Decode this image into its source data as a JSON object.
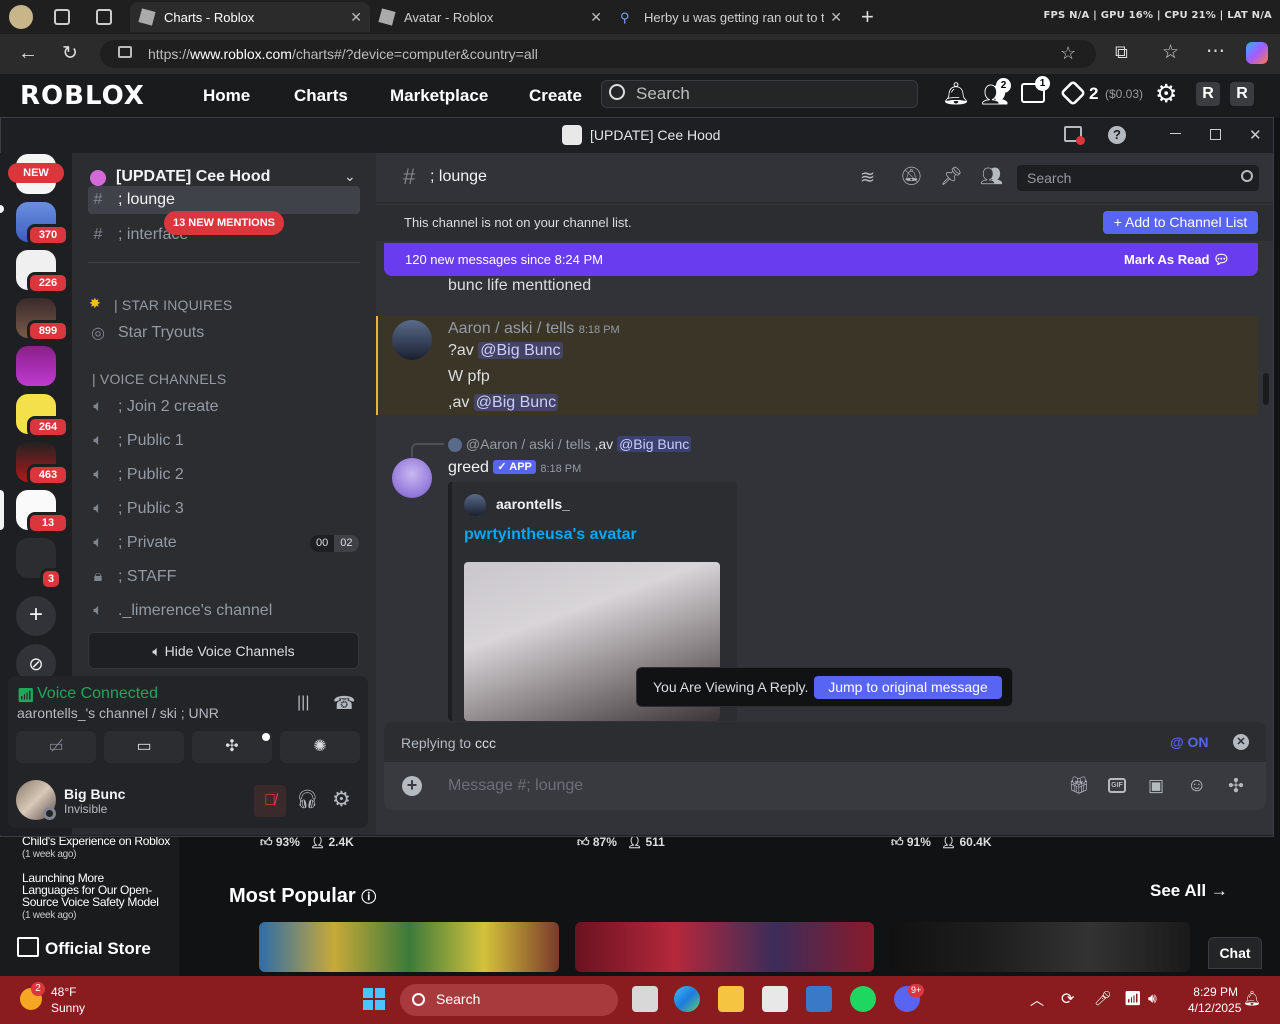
{
  "browser": {
    "tabs": [
      {
        "label": "Charts - Roblox",
        "active": true
      },
      {
        "label": "Avatar - Roblox",
        "active": false
      },
      {
        "label": "Herby u was getting ran out to th",
        "active": false
      }
    ],
    "perf": "FPS N/A | GPU 16% | CPU 21% | LAT N/A",
    "url_prefix": "https://",
    "url_host": "www.roblox.com",
    "url_path": "/charts#/?device=computer&country=all"
  },
  "roblox": {
    "logo": "ROBLOX",
    "nav": [
      "Home",
      "Charts",
      "Marketplace",
      "Create"
    ],
    "search_placeholder": "Search",
    "friend_badge": "2",
    "msg_badge": "1",
    "robux": "2",
    "robux_value": "($0.03)",
    "news": [
      {
        "title": "Child's Experience on Roblox",
        "age": "(1 week ago)"
      },
      {
        "title": "Launching More Languages for Our Open-Source Voice Safety Model",
        "age": "(1 week ago)"
      }
    ],
    "official_store": "Official Store",
    "stats": [
      {
        "like": "93%",
        "players": "2.4K"
      },
      {
        "like": "87%",
        "players": "511"
      },
      {
        "like": "91%",
        "players": "60.4K"
      }
    ],
    "most_popular": "Most Popular",
    "see_all": "See All",
    "chat": "Chat"
  },
  "discord": {
    "window_title": "[UPDATE] Cee Hood",
    "new_badge": "NEW",
    "server_counts": [
      "370",
      "226",
      "899",
      "264",
      "463",
      "13",
      "3"
    ],
    "guild_name": "[UPDATE] Cee Hood",
    "mentions_pill": "13 NEW MENTIONS",
    "channels_top": [
      {
        "name": "; lounge"
      },
      {
        "name": "; interface"
      }
    ],
    "star_category": "| STAR INQUIRES",
    "star_tryouts": "Star Tryouts",
    "voice_category": "| VOICE CHANNELS",
    "voice_channels": [
      {
        "name": "; Join 2 create",
        "icon": "speaker-icon"
      },
      {
        "name": "; Public 1",
        "icon": "speaker-icon"
      },
      {
        "name": "; Public 2",
        "icon": "speaker-icon"
      },
      {
        "name": "; Public 3",
        "icon": "speaker-icon"
      },
      {
        "name": "; Private",
        "icon": "speaker-icon",
        "users": "00",
        "limit": "02"
      },
      {
        "name": "; STAFF",
        "icon": "lock-icon"
      },
      {
        "name": "._limerence's channel",
        "icon": "speaker-icon"
      }
    ],
    "hide_voice": "Hide Voice Channels",
    "voice_connected": "Voice Connected",
    "voice_channel_path": "aarontells_'s channel / ski ; UNR",
    "user_name": "Big Bunc",
    "user_status": "Invisible",
    "channel_header": "; lounge",
    "search_placeholder": "Search",
    "notice": "This channel is not on your channel list.",
    "add_channel_list": "Add to Channel List",
    "new_messages": "120 new messages since 8:24 PM",
    "mark_as_read": "Mark As Read",
    "messages": {
      "m0_text": "bunc life menttioned",
      "m1_author": "Aaron / aski / tells",
      "m1_time": "8:18 PM",
      "m1_line1_prefix": "?av",
      "m1_line1_mention": "@Big Bunc",
      "m1_line2": "W pfp",
      "m1_line3_prefix": ",av",
      "m1_line3_mention": "@Big Bunc",
      "reply_ref_author": "@Aaron / aski / tells",
      "reply_ref_text": ",av",
      "reply_ref_mention": "@Big Bunc",
      "m2_author": "greed",
      "m2_tag": "APP",
      "m2_time": "8:18 PM",
      "embed_author": "aarontells_",
      "embed_title": "pwrtyintheusa's avatar"
    },
    "viewing_reply": "You Are Viewing A Reply.",
    "jump_original": "Jump to original message",
    "replying_to_label": "Replying to",
    "replying_to_name": "ccc",
    "mention_toggle": "@ ON",
    "message_placeholder": "Message #; lounge"
  },
  "taskbar": {
    "weather_badge": "2",
    "temp": "48°F",
    "condition": "Sunny",
    "search": "Search",
    "discord_badge": "9+",
    "time": "8:29 PM",
    "date": "4/12/2025"
  },
  "colors": {
    "discord_blurple": "#5865f2",
    "new_msg_bar": "#6a3cf0",
    "alert_red": "#da373c",
    "voice_green": "#23a55a",
    "taskbar": "#8a1b1e"
  }
}
